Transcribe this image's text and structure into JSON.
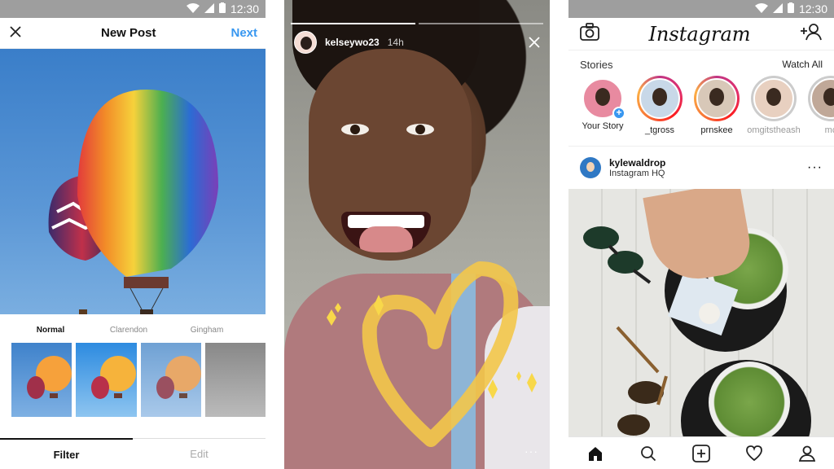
{
  "status_bar": {
    "time": "12:30"
  },
  "new_post": {
    "title": "New Post",
    "next_label": "Next",
    "filters": [
      "Normal",
      "Clarendon",
      "Gingham"
    ],
    "selected_filter": "Normal",
    "tabs": [
      "Filter",
      "Edit"
    ],
    "active_tab": "Filter"
  },
  "story": {
    "username": "kelseywo23",
    "time_ago": "14h",
    "progress_segments": 2,
    "active_segment": 0
  },
  "feed": {
    "logo": "Instagram",
    "stories_title": "Stories",
    "watch_all_label": "Watch All",
    "stories": [
      {
        "label": "Your Story"
      },
      {
        "label": "_tgross"
      },
      {
        "label": "prnskee"
      },
      {
        "label": "omgitstheash"
      },
      {
        "label": "mc"
      }
    ],
    "post": {
      "username": "kylewaldrop",
      "location": "Instagram HQ"
    }
  },
  "colors": {
    "accent": "#3897f0",
    "story_ring": "#c13584",
    "heart_doodle": "#f3c74a"
  }
}
